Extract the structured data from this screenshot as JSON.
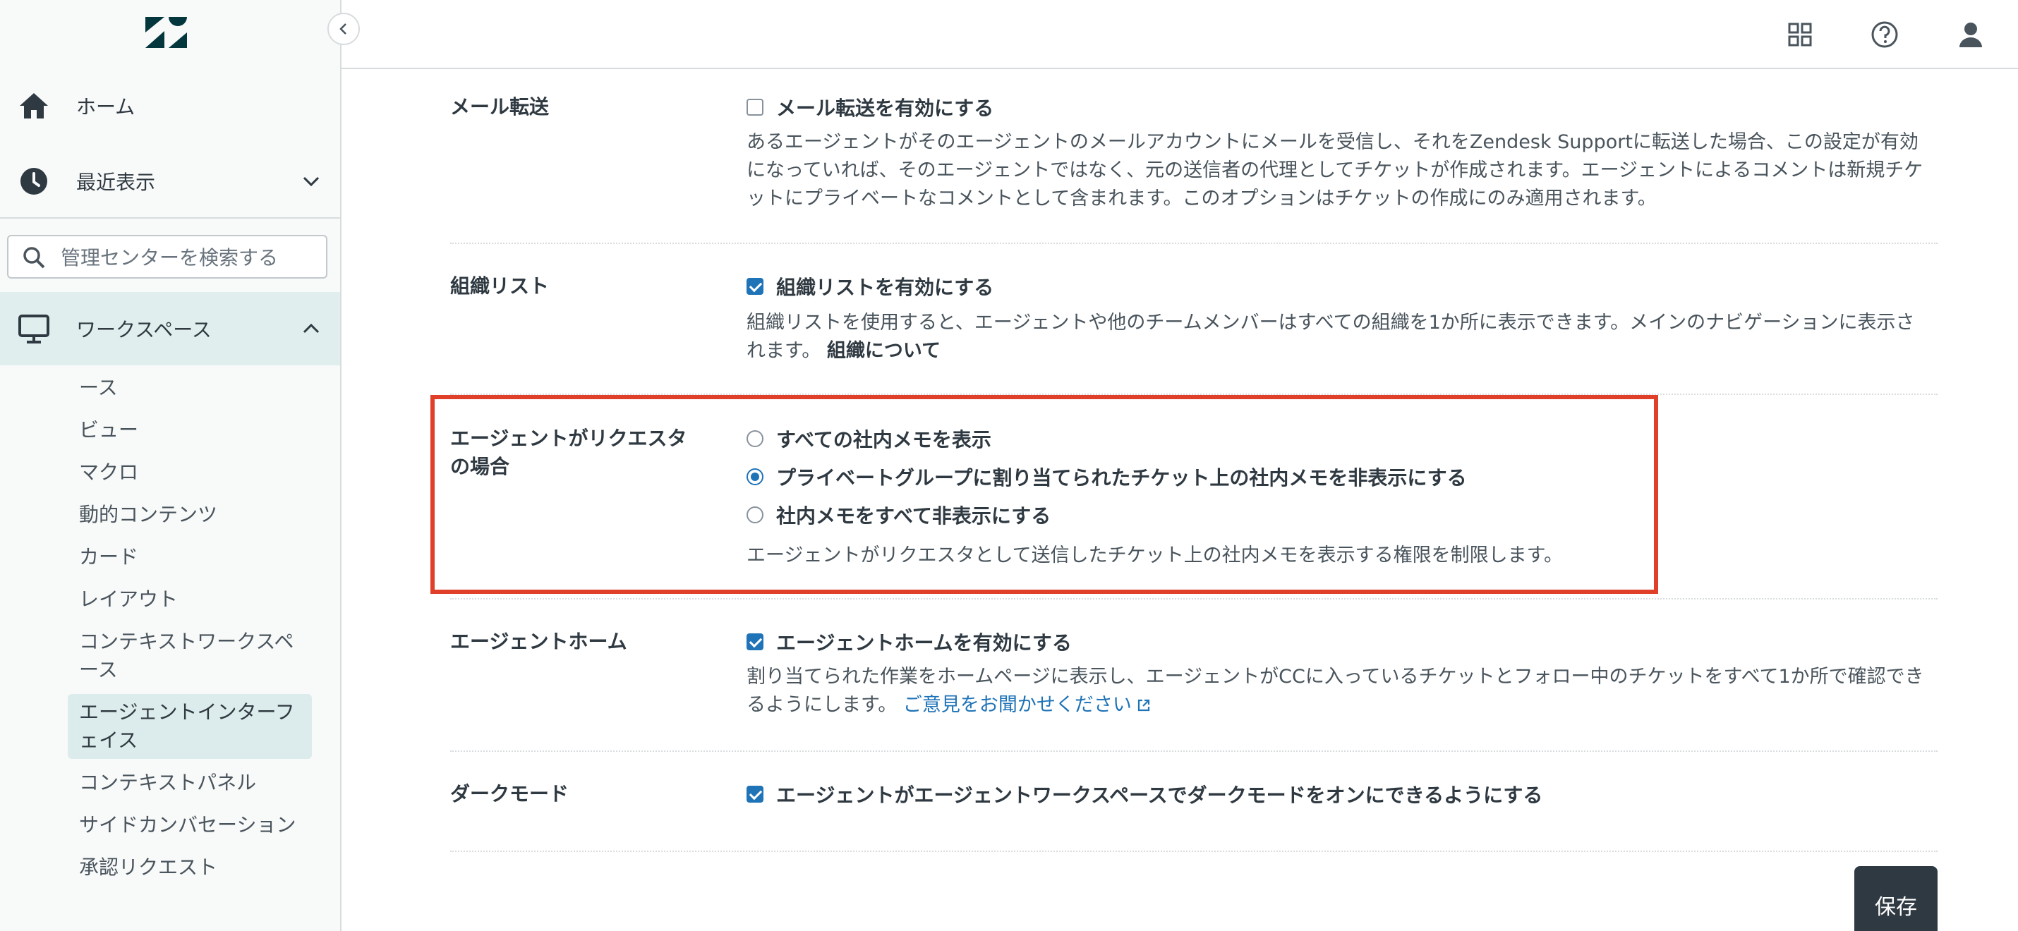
{
  "sidebar": {
    "nav": [
      {
        "label": "ホーム",
        "icon": "home-icon"
      },
      {
        "label": "最近表示",
        "icon": "clock-icon"
      },
      {
        "label": "ワークスペース",
        "icon": "monitor-icon"
      }
    ],
    "search_placeholder": "管理センターを検索する",
    "sub_items": [
      "ース",
      "ビュー",
      "マクロ",
      "動的コンテンツ",
      "カード",
      "レイアウト",
      "コンテキストワークスペース",
      "エージェントインターフェイス",
      "コンテキストパネル",
      "サイドカンバセーション",
      "承認リクエスト"
    ]
  },
  "settings": {
    "mail_forward": {
      "label": "メール転送",
      "option": "メール転送を有効にする",
      "checked": false,
      "description": "あるエージェントがそのエージェントのメールアカウントにメールを受信し、それをZendesk Supportに転送した場合、この設定が有効になっていれば、そのエージェントではなく、元の送信者の代理としてチケットが作成されます。エージェントによるコメントは新規チケットにプライベートなコメントとして含まれます。このオプションはチケットの作成にのみ適用されます。"
    },
    "org_list": {
      "label": "組織リスト",
      "option": "組織リストを有効にする",
      "checked": true,
      "description": "組織リストを使用すると、エージェントや他のチームメンバーはすべての組織を1か所に表示できます。メインのナビゲーションに表示されます。",
      "link": "組織について"
    },
    "requester": {
      "label": "エージェントがリクエスタの場合",
      "options": [
        {
          "label": "すべての社内メモを表示",
          "checked": false
        },
        {
          "label": "プライベートグループに割り当てられたチケット上の社内メモを非表示にする",
          "checked": true
        },
        {
          "label": "社内メモをすべて非表示にする",
          "checked": false
        }
      ],
      "description": "エージェントがリクエスタとして送信したチケット上の社内メモを表示する権限を制限します。"
    },
    "agent_home": {
      "label": "エージェントホーム",
      "option": "エージェントホームを有効にする",
      "checked": true,
      "description": "割り当てられた作業をホームページに表示し、エージェントがCCに入っているチケットとフォロー中のチケットをすべて1か所で確認できるようにします。",
      "link": "ご意見をお聞かせください"
    },
    "dark_mode": {
      "label": "ダークモード",
      "option": "エージェントがエージェントワークスペースでダークモードをオンにできるようにする",
      "checked": true
    }
  },
  "save_label": "保存",
  "colors": {
    "accent": "#1f73b7",
    "highlight": "#e0402a",
    "button": "#2f3941"
  }
}
